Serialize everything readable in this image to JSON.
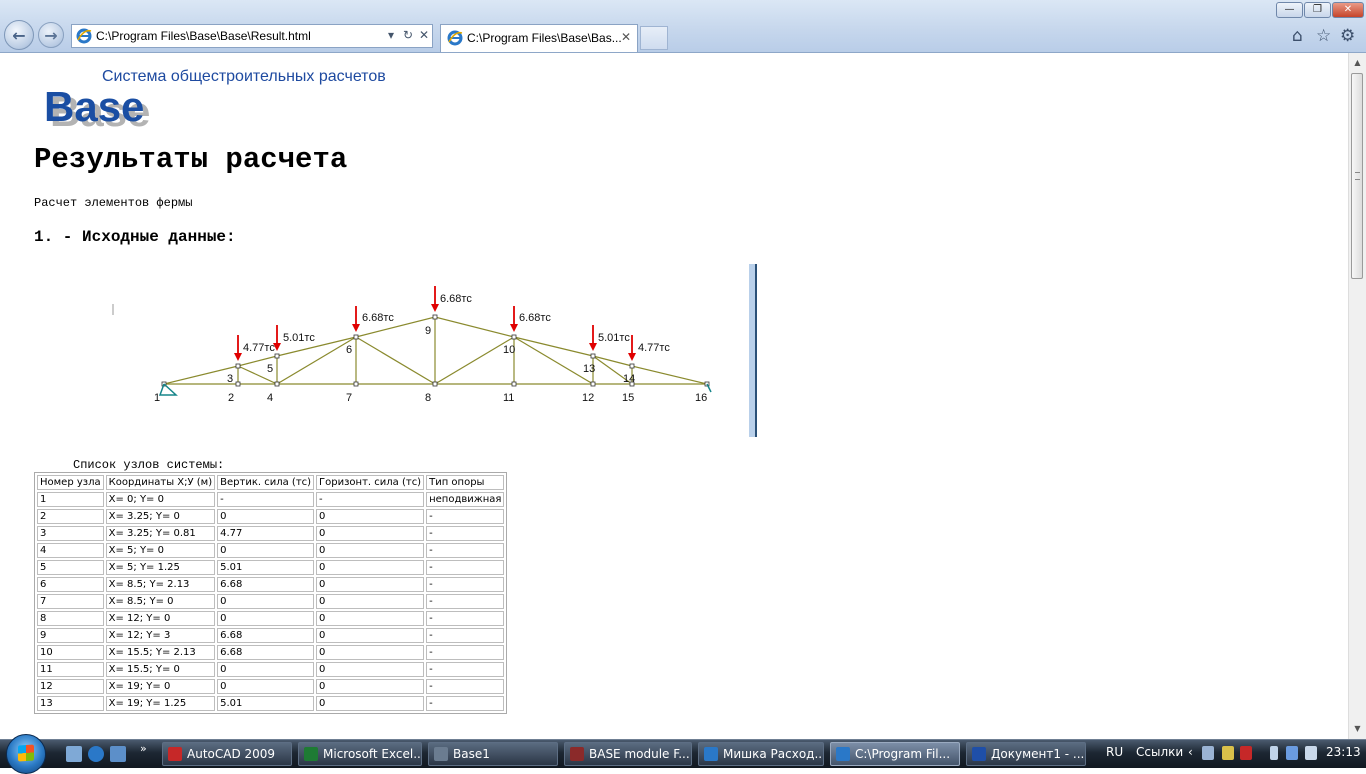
{
  "browser": {
    "address": "C:\\Program Files\\Base\\Base\\Result.html",
    "tabs": [
      {
        "title": "C:\\Program Files\\Base\\Bas..."
      }
    ],
    "window_buttons": {
      "minimize": "—",
      "maximize": "❐",
      "close": "✕"
    }
  },
  "page": {
    "logo_text": "Base",
    "logo_subtitle": "Система общестроительных расчетов",
    "title": "Результаты расчета",
    "subtitle": "Расчет элементов фермы",
    "section_heading": "1. - Исходные данные:",
    "nodes_caption": "Список узлов системы:"
  },
  "diagram": {
    "line_color": "#8a8a2e",
    "arrow_color": "#e00000",
    "support_color": "#16858a",
    "node_labels": [
      "1",
      "2",
      "3",
      "4",
      "5",
      "6",
      "7",
      "8",
      "9",
      "10",
      "11",
      "12",
      "13",
      "14",
      "15",
      "16"
    ],
    "loads": [
      "4.77тс",
      "5.01тс",
      "6.68тс",
      "6.68тс",
      "6.68тс",
      "5.01тс",
      "4.77тс"
    ]
  },
  "nodes_table": {
    "headers": [
      "Номер узла",
      "Координаты X;У (м)",
      "Вертик. сила (тс)",
      "Горизонт. сила (тс)",
      "Тип опоры"
    ],
    "rows": [
      [
        "1",
        "X= 0; Y= 0",
        "-",
        "-",
        "неподвижная"
      ],
      [
        "2",
        "X= 3.25; Y= 0",
        "0",
        "0",
        "-"
      ],
      [
        "3",
        "X= 3.25; Y= 0.81",
        "4.77",
        "0",
        "-"
      ],
      [
        "4",
        "X= 5; Y= 0",
        "0",
        "0",
        "-"
      ],
      [
        "5",
        "X= 5; Y= 1.25",
        "5.01",
        "0",
        "-"
      ],
      [
        "6",
        "X= 8.5; Y= 2.13",
        "6.68",
        "0",
        "-"
      ],
      [
        "7",
        "X= 8.5; Y= 0",
        "0",
        "0",
        "-"
      ],
      [
        "8",
        "X= 12; Y= 0",
        "0",
        "0",
        "-"
      ],
      [
        "9",
        "X= 12; Y= 3",
        "6.68",
        "0",
        "-"
      ],
      [
        "10",
        "X= 15.5; Y= 2.13",
        "6.68",
        "0",
        "-"
      ],
      [
        "11",
        "X= 15.5; Y= 0",
        "0",
        "0",
        "-"
      ],
      [
        "12",
        "X= 19; Y= 0",
        "0",
        "0",
        "-"
      ],
      [
        "13",
        "X= 19; Y= 1.25",
        "5.01",
        "0",
        "-"
      ]
    ]
  },
  "taskbar": {
    "tasks": [
      {
        "label": "AutoCAD 2009",
        "color": "#c62828"
      },
      {
        "label": "Microsoft Excel...",
        "color": "#1e7b34"
      },
      {
        "label": "Base1",
        "color": "#6b7c90"
      },
      {
        "label": "BASE module F...",
        "color": "#8b2a2a"
      },
      {
        "label": "Мишка Расход...",
        "color": "#2a78c8"
      },
      {
        "label": "C:\\Program Fil...",
        "color": "#2a78c8"
      },
      {
        "label": "Документ1 - ...",
        "color": "#1f4fa8"
      }
    ],
    "lang": "RU",
    "links": "Ссылки",
    "clock": "23:13"
  }
}
